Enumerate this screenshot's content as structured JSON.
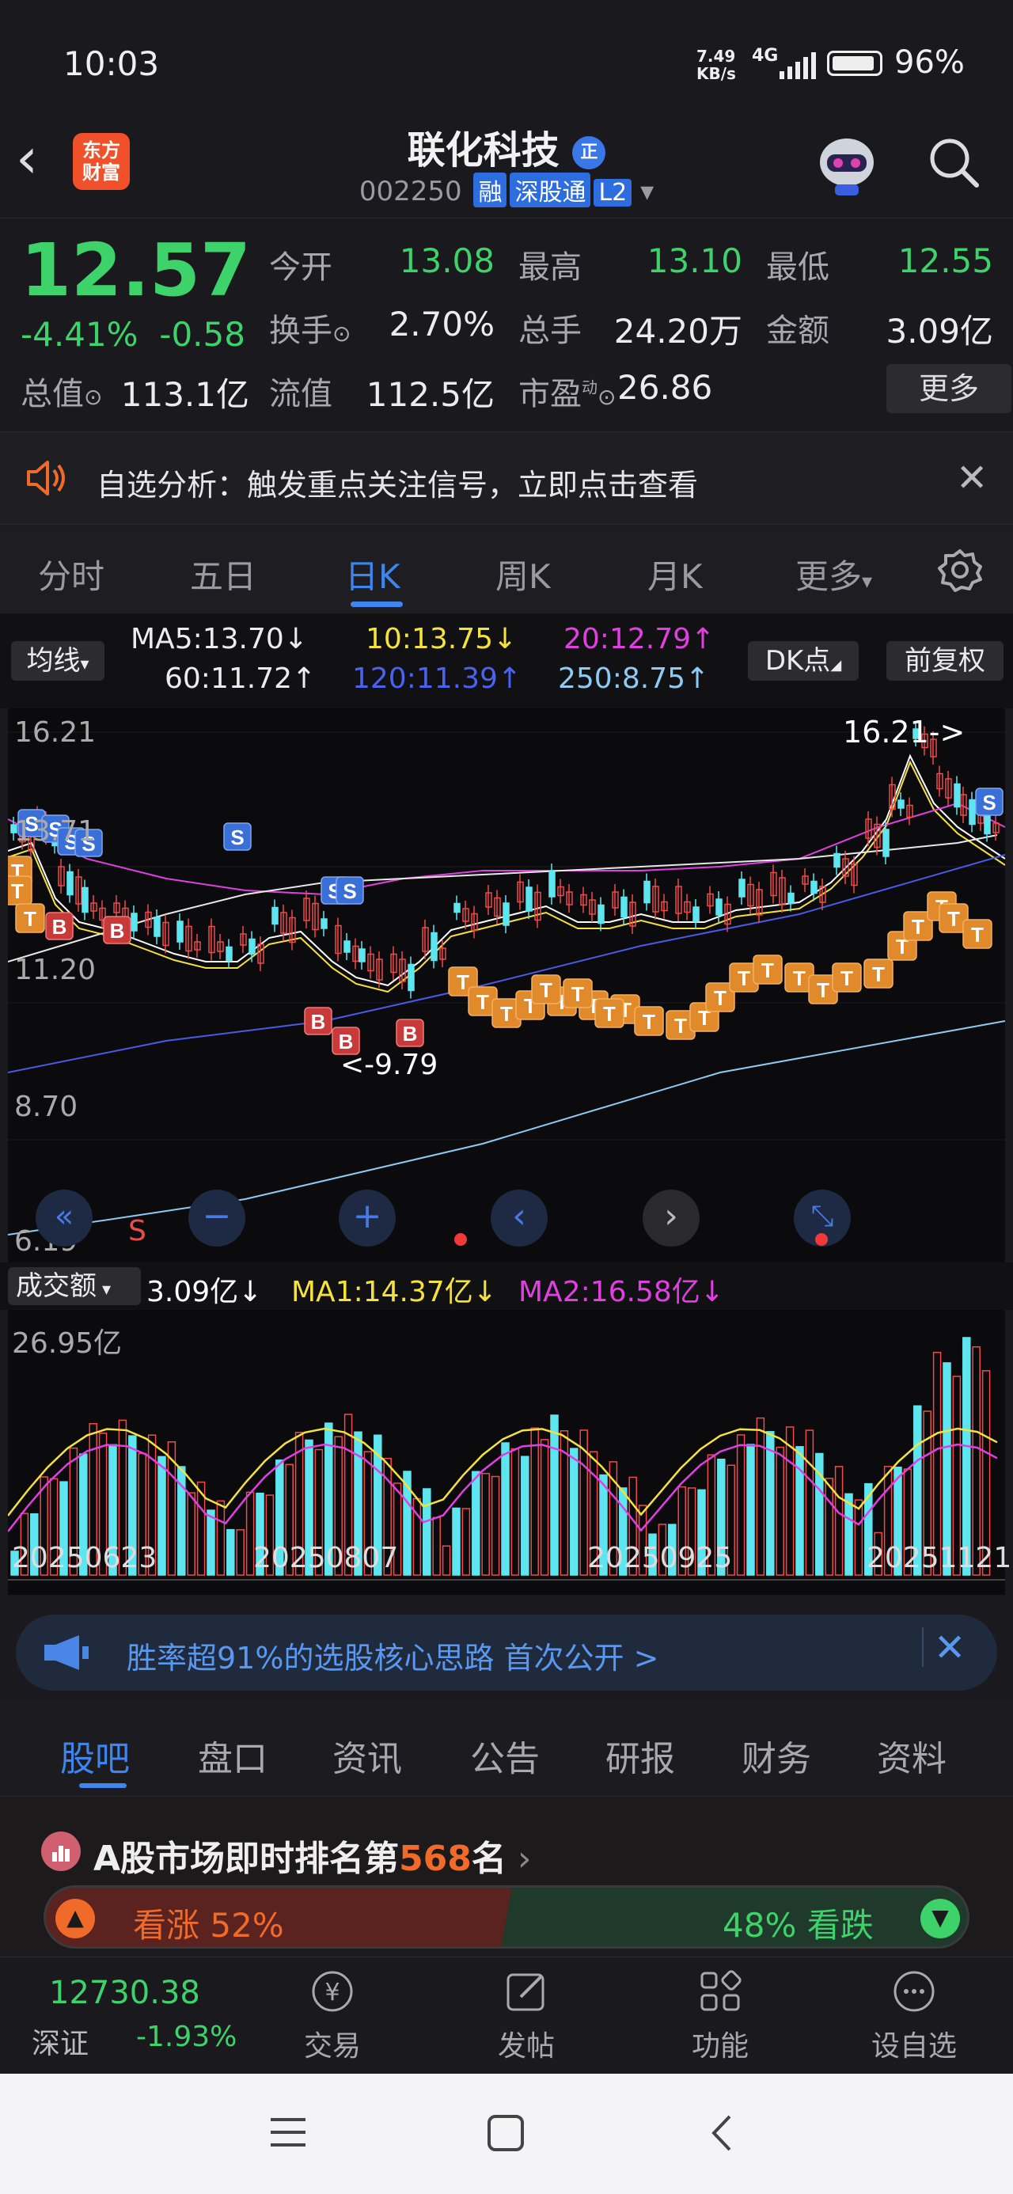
{
  "status": {
    "time": "10:03",
    "net_speed": "7.49",
    "net_unit": "KB/s",
    "signal": "4G",
    "battery": "96%"
  },
  "header": {
    "logo": "东方财富",
    "stock_name": "联化科技",
    "verify_badge": "正",
    "code": "002250",
    "tags": [
      "融",
      "深股通",
      "L2"
    ]
  },
  "quote": {
    "price": "12.57",
    "change_pct": "-4.41%",
    "change": "-0.58",
    "open_label": "今开",
    "open": "13.08",
    "high_label": "最高",
    "high": "13.10",
    "low_label": "最低",
    "low": "12.55",
    "turnover_label": "换手",
    "turnover": "2.70%",
    "volume_label": "总手",
    "volume": "24.20万",
    "amount_label": "金额",
    "amount": "3.09亿",
    "mcap_label": "总值",
    "mcap": "113.1亿",
    "float_label": "流值",
    "float": "112.5亿",
    "pe_label": "市盈",
    "pe_sup": "动",
    "pe": "26.86",
    "more": "更多"
  },
  "notice": {
    "text": "自选分析：触发重点关注信号，立即点击查看"
  },
  "ktabs": [
    "分时",
    "五日",
    "日K",
    "周K",
    "月K",
    "更多"
  ],
  "ma": {
    "selector": "均线",
    "ma5": "MA5:13.70",
    "ma10": "10:13.75",
    "ma20": "20:12.79",
    "ma60": "60:11.72",
    "ma120": "120:11.39",
    "ma250": "250:8.75",
    "dk": "DK点",
    "adjust": "前复权",
    "arrows": {
      "ma5": "↓",
      "ma10": "↓",
      "ma20": "↑",
      "ma60": "↑",
      "ma120": "↑",
      "ma250": "↑"
    }
  },
  "chart": {
    "y_ticks": [
      "16.21",
      "13.71",
      "11.20",
      "8.70",
      "6.19"
    ],
    "high_marker": "16.21->",
    "low_marker": "<-9.79",
    "s_label": "S"
  },
  "volume": {
    "selector": "成交额",
    "value": "3.09亿↓",
    "ma1": "MA1:14.37亿↓",
    "ma2": "MA2:16.58亿↓",
    "y_top": "26.95亿",
    "dates": [
      "20250623",
      "20250807",
      "20250925",
      "20251121"
    ]
  },
  "ad": {
    "text": "胜率超91%的选股核心思路 首次公开 >"
  },
  "btabs": [
    "股吧",
    "盘口",
    "资讯",
    "公告",
    "研报",
    "财务",
    "资料"
  ],
  "rank": {
    "prefix": "A股市场即时排名第",
    "rank": "568",
    "suffix": "名",
    "up": "看涨 52%",
    "down": "48% 看跌"
  },
  "nav": {
    "index_value": "12730.38",
    "index_name": "深证",
    "index_change": "-1.93%",
    "items": [
      "交易",
      "发帖",
      "功能",
      "设自选"
    ]
  },
  "colors": {
    "up": "#f04a4a",
    "down": "#3dd26a",
    "accent": "#3e86ee",
    "ma5": "#ffffff",
    "ma10": "#f5e23c",
    "ma20": "#e040e0",
    "ma120": "#4a5ae8",
    "ma250": "#8ecbf4"
  }
}
